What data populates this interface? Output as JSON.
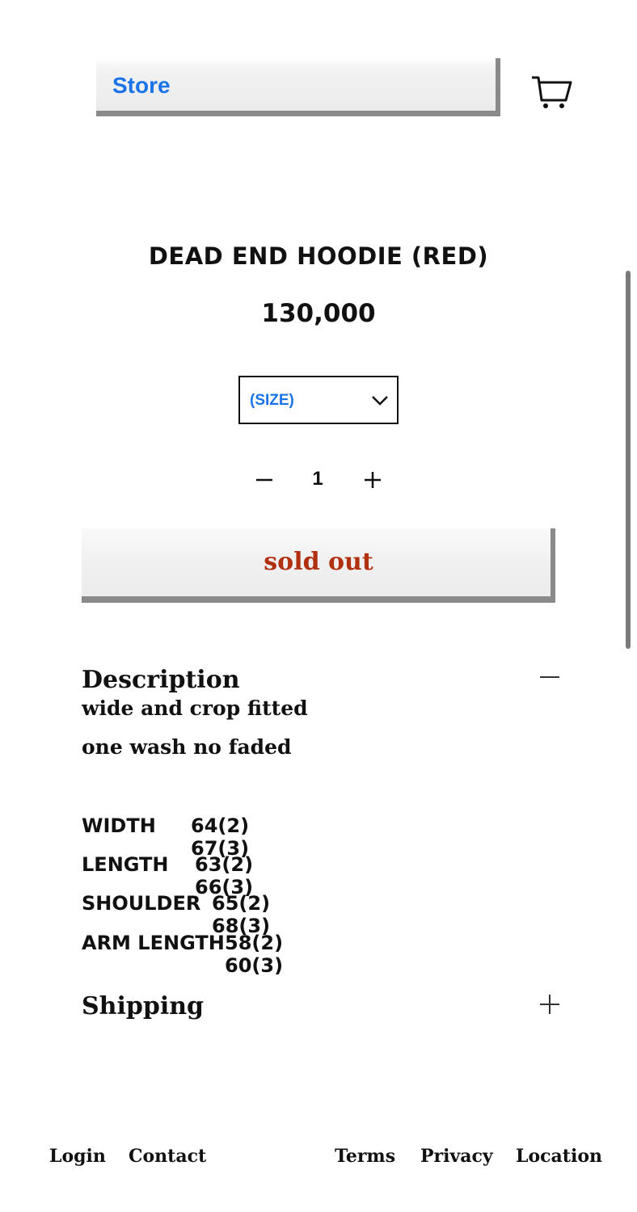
{
  "header": {
    "store_label": "Store"
  },
  "product": {
    "title": "DEAD END HOODIE (RED)",
    "price": "130,000",
    "size_select": {
      "value": "(SIZE)"
    },
    "quantity": "1",
    "sold_out_label": "sold out",
    "accent_color": "#b03010",
    "link_color": "#1a73e8"
  },
  "description": {
    "title": "Description",
    "lines": [
      "wide and crop fitted",
      "one wash no faded"
    ],
    "specs": [
      {
        "label": "WIDTH",
        "value": "64(2) 67(3)"
      },
      {
        "label": "LENGTH",
        "value": "63(2) 66(3)"
      },
      {
        "label": "SHOULDER",
        "value": "65(2) 68(3)"
      },
      {
        "label": "ARM LENGTH",
        "value": "58(2) 60(3)"
      }
    ]
  },
  "shipping": {
    "title": "Shipping"
  },
  "footer": {
    "links": [
      "Login",
      "Contact",
      "Terms",
      "Privacy",
      "Location"
    ]
  },
  "icons": {
    "cart": "cart-icon",
    "dropdown": "chevron-down-icon",
    "minus": "minus-icon",
    "plus": "plus-icon"
  }
}
